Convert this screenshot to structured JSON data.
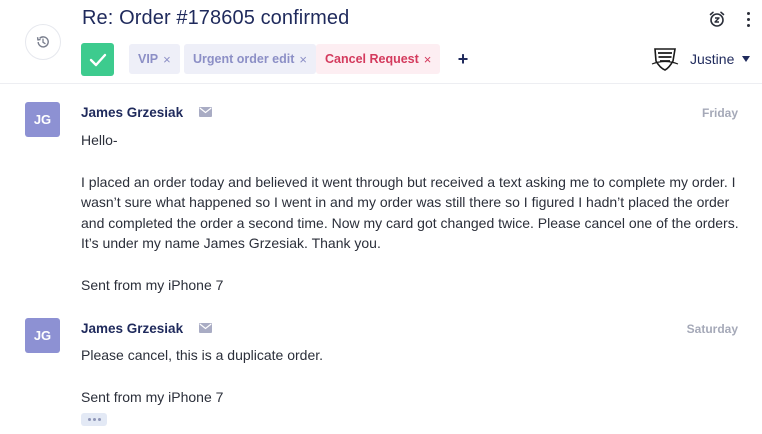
{
  "ticket": {
    "title": "Re: Order #178605 confirmed",
    "tags": [
      {
        "label": "VIP",
        "remove": "×"
      },
      {
        "label": "Urgent order edit",
        "remove": "×"
      },
      {
        "label": "Cancel Request",
        "remove": "×"
      }
    ],
    "add_tag_label": "+",
    "agent_name": "Justine"
  },
  "icons": {
    "history": "history-icon",
    "snooze": "alarm-clock-icon",
    "more": "more-vertical-icon",
    "check": "check-icon",
    "mail": "mail-icon",
    "agent_logo": "shield-logo"
  },
  "colors": {
    "title": "#1f2a5c",
    "check_button": "#3dcb8e",
    "tag_default_bg": "#eeeff8",
    "tag_default_text": "#8c8fc6",
    "tag_cancel_bg": "#fdeef2",
    "tag_cancel_text": "#d43a5d",
    "avatar_bg": "#8d91d3"
  },
  "messages": [
    {
      "initials": "JG",
      "sender": "James Grzesiak",
      "date": "Friday",
      "paragraphs": [
        "Hello-",
        "I placed an order today and believed it went through but received a text asking me to complete my order. I wasn’t sure what happened so I went in and my order was still there so I figured I hadn’t placed the order and completed the order a second time. Now my card got changed twice. Please cancel one of the orders. It’s under my name James Grzesiak. Thank you.",
        "Sent from my iPhone 7"
      ]
    },
    {
      "initials": "JG",
      "sender": "James Grzesiak",
      "date": "Saturday",
      "paragraphs": [
        "Please cancel, this is a duplicate order.",
        "Sent from my iPhone 7"
      ]
    }
  ]
}
